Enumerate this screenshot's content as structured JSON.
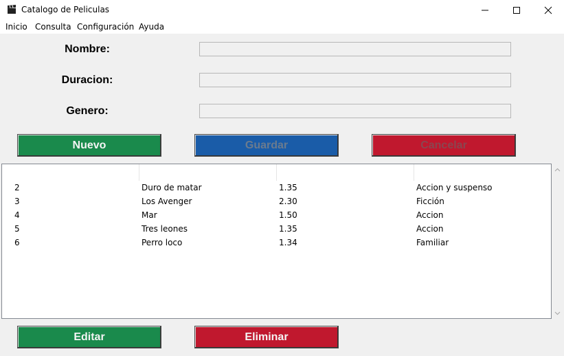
{
  "window": {
    "title": "Catalogo de Peliculas",
    "icon": "clapperboard-icon"
  },
  "menu": {
    "items": [
      "Inicio",
      "Consulta",
      "Configuración",
      "Ayuda"
    ]
  },
  "form": {
    "nombre": {
      "label": "Nombre:",
      "value": ""
    },
    "duracion": {
      "label": "Duracion:",
      "value": ""
    },
    "genero": {
      "label": "Genero:",
      "value": ""
    }
  },
  "buttons": {
    "nuevo": "Nuevo",
    "guardar": "Guardar",
    "cancelar": "Cancelar",
    "editar": "Editar",
    "eliminar": "Eliminar"
  },
  "table": {
    "headers": [
      "",
      "",
      "",
      ""
    ],
    "rows": [
      [
        "2",
        "Duro de matar",
        "1.35",
        "Accion y suspenso"
      ],
      [
        "3",
        "Los Avenger",
        "2.30",
        "Ficción"
      ],
      [
        "4",
        "Mar",
        "1.50",
        "Accion"
      ],
      [
        "5",
        "Tres leones",
        "1.35",
        "Accion"
      ],
      [
        "6",
        "Perro loco",
        "1.34",
        "Familiar"
      ]
    ]
  },
  "colors": {
    "green": "#1a8a4c",
    "blue": "#1a5ca8",
    "red": "#c0182e",
    "background": "#f0f0f0"
  }
}
